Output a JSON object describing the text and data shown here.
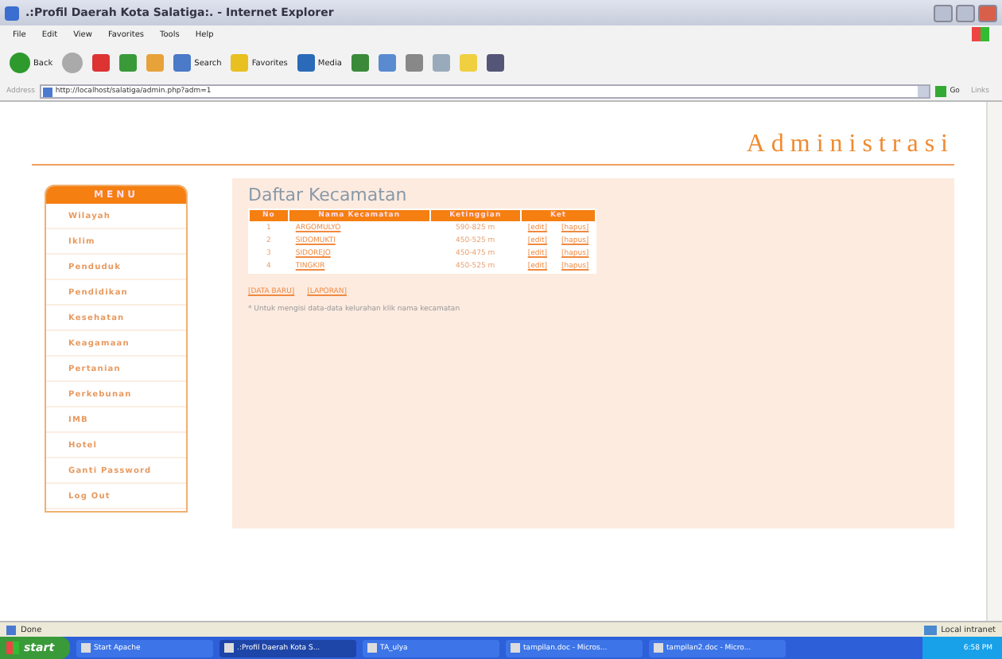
{
  "window": {
    "title": ".:Profil Daerah Kota Salatiga:. - Internet Explorer"
  },
  "menu_bar": [
    "File",
    "Edit",
    "View",
    "Favorites",
    "Tools",
    "Help"
  ],
  "toolbar": [
    {
      "kind": "back",
      "label": "Back"
    },
    {
      "kind": "forward"
    },
    {
      "kind": "stop"
    },
    {
      "kind": "refresh"
    },
    {
      "kind": "home"
    },
    {
      "kind": "search",
      "label": "Search"
    },
    {
      "kind": "favorites",
      "label": "Favorites"
    },
    {
      "kind": "media",
      "label": "Media"
    },
    {
      "kind": "history"
    },
    {
      "kind": "mail"
    },
    {
      "kind": "print"
    },
    {
      "kind": "edit"
    },
    {
      "kind": "folder"
    },
    {
      "kind": "messenger"
    }
  ],
  "address_bar": {
    "label": "Address",
    "value": "http://localhost/salatiga/admin.php?adm=1",
    "go": "Go",
    "links": "Links"
  },
  "page": {
    "header": "Administrasi",
    "menu": {
      "title": "MENU",
      "items": [
        "Wilayah",
        "Iklim",
        "Penduduk",
        "Pendidikan",
        "Kesehatan",
        "Keagamaan",
        "Pertanian",
        "Perkebunan",
        "IMB",
        "Hotel",
        "Ganti Password",
        "Log Out"
      ]
    },
    "heading": "Daftar Kecamatan",
    "table": {
      "columns": [
        "No",
        "Nama Kecamatan",
        "Ketinggian",
        "Ket"
      ],
      "rows": [
        {
          "no": "1",
          "name": "ARGOMULYO",
          "height": "590-825 m",
          "edit": "[edit]",
          "delete": "[hapus]"
        },
        {
          "no": "2",
          "name": "SIDOMUKTI",
          "height": "450-525 m",
          "edit": "[edit]",
          "delete": "[hapus]"
        },
        {
          "no": "3",
          "name": "SIDOREJO",
          "height": "450-475 m",
          "edit": "[edit]",
          "delete": "[hapus]"
        },
        {
          "no": "4",
          "name": "TINGKIR",
          "height": "450-525 m",
          "edit": "[edit]",
          "delete": "[hapus]"
        }
      ]
    },
    "links": [
      "[DATA BARU]",
      "[LAPORAN]"
    ],
    "note": "* Untuk mengisi data-data kelurahan klik nama kecamatan"
  },
  "status_bar": {
    "text": "Done",
    "zone": "Local intranet"
  },
  "taskbar": {
    "start": "start",
    "items": [
      {
        "label": "Start Apache",
        "selected": false
      },
      {
        "label": ".:Profil Daerah Kota S...",
        "selected": true
      },
      {
        "label": "TA_ulya",
        "selected": false
      },
      {
        "label": "tampilan.doc - Micros...",
        "selected": false
      },
      {
        "label": "tampilan2.doc - Micro...",
        "selected": false
      }
    ],
    "clock": "6:58 PM"
  }
}
